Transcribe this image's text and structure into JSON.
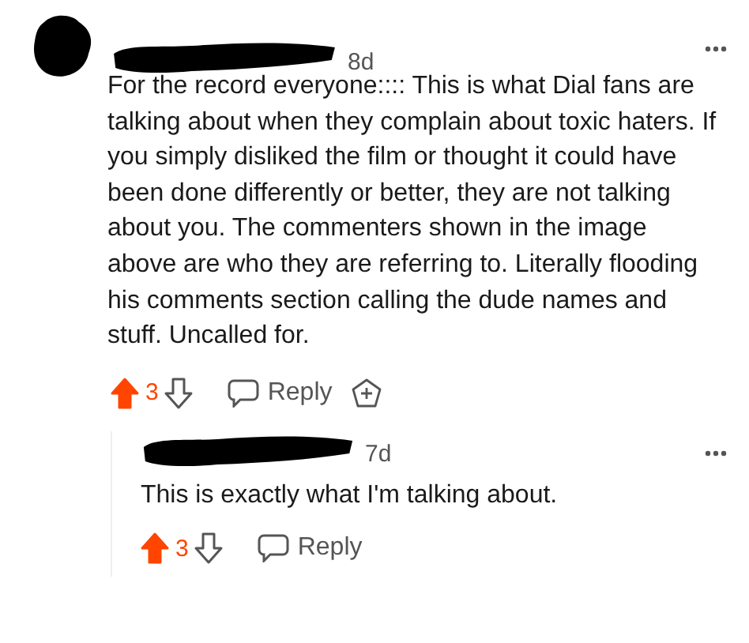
{
  "comments": [
    {
      "age": "8d",
      "body": "For the record everyone:::: This is what Dial fans are talking about when they complain about toxic haters. If you simply disliked the film or thought it could have been done differently or better, they are not talking about you. The commenters shown in the image above are who they are referring to. Literally flooding his comments section calling the dude names and stuff. Uncalled for.",
      "upvoted": true,
      "score": "3",
      "reply": "Reply",
      "has_award": true,
      "nested": false
    },
    {
      "age": "7d",
      "body": "This is exactly what I'm talking about.",
      "upvoted": true,
      "score": "3",
      "reply": "Reply",
      "has_award": false,
      "nested": true
    }
  ]
}
